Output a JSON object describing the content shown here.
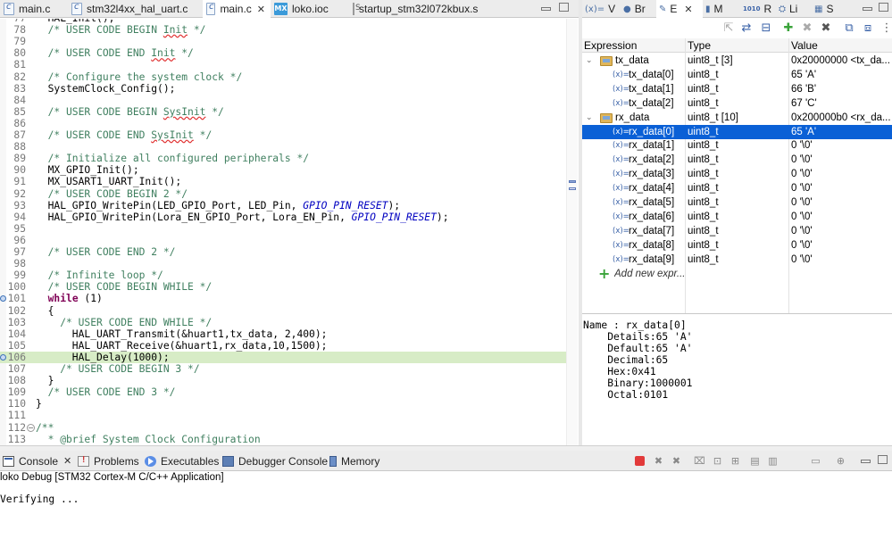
{
  "editor": {
    "tabs": [
      {
        "label": "main.c",
        "icon": "c-file-icon",
        "active": false,
        "closable": false
      },
      {
        "label": "stm32l4xx_hal_uart.c",
        "icon": "c-file-icon",
        "active": false,
        "closable": false
      },
      {
        "label": "main.c",
        "icon": "c-file-icon",
        "active": true,
        "closable": true
      },
      {
        "label": "loko.ioc",
        "icon": "mx-file-icon",
        "active": false,
        "closable": false
      },
      {
        "label": "startup_stm32l072kbux.s",
        "icon": "asm-file-icon",
        "active": false,
        "closable": false
      }
    ],
    "lines": [
      {
        "n": "77",
        "text": "  HAL_Init();"
      },
      {
        "n": "78",
        "text": "  /* USER CODE BEGIN Init */"
      },
      {
        "n": "79",
        "text": ""
      },
      {
        "n": "80",
        "text": "  /* USER CODE END Init */"
      },
      {
        "n": "81",
        "text": ""
      },
      {
        "n": "82",
        "text": "  /* Configure the system clock */"
      },
      {
        "n": "83",
        "text": "  SystemClock_Config();"
      },
      {
        "n": "84",
        "text": ""
      },
      {
        "n": "85",
        "text": "  /* USER CODE BEGIN SysInit */"
      },
      {
        "n": "86",
        "text": ""
      },
      {
        "n": "87",
        "text": "  /* USER CODE END SysInit */"
      },
      {
        "n": "88",
        "text": ""
      },
      {
        "n": "89",
        "text": "  /* Initialize all configured peripherals */"
      },
      {
        "n": "90",
        "text": "  MX_GPIO_Init();"
      },
      {
        "n": "91",
        "text": "  MX_USART1_UART_Init();"
      },
      {
        "n": "92",
        "text": "  /* USER CODE BEGIN 2 */"
      },
      {
        "n": "93",
        "text": "  HAL_GPIO_WritePin(LED_GPIO_Port, LED_Pin, GPIO_PIN_RESET);"
      },
      {
        "n": "94",
        "text": "  HAL_GPIO_WritePin(Lora_EN_GPIO_Port, Lora_EN_Pin, GPIO_PIN_RESET);"
      },
      {
        "n": "95",
        "text": ""
      },
      {
        "n": "96",
        "text": ""
      },
      {
        "n": "97",
        "text": "  /* USER CODE END 2 */"
      },
      {
        "n": "98",
        "text": ""
      },
      {
        "n": "99",
        "text": "  /* Infinite loop */"
      },
      {
        "n": "100",
        "text": "  /* USER CODE BEGIN WHILE */"
      },
      {
        "n": "101",
        "text": "  while (1)"
      },
      {
        "n": "102",
        "text": "  {"
      },
      {
        "n": "103",
        "text": "    /* USER CODE END WHILE */"
      },
      {
        "n": "104",
        "text": "      HAL_UART_Transmit(&huart1,tx_data, 2,400);"
      },
      {
        "n": "105",
        "text": "      HAL_UART_Receive(&huart1,rx_data,10,1500);"
      },
      {
        "n": "106",
        "text": "      HAL_Delay(1000);"
      },
      {
        "n": "107",
        "text": "    /* USER CODE BEGIN 3 */"
      },
      {
        "n": "108",
        "text": "  }"
      },
      {
        "n": "109",
        "text": "  /* USER CODE END 3 */"
      },
      {
        "n": "110",
        "text": "}"
      },
      {
        "n": "111",
        "text": ""
      },
      {
        "n": "112",
        "text": "/**"
      },
      {
        "n": "113",
        "text": "  * @brief System Clock Configuration"
      }
    ]
  },
  "views": {
    "tabs": [
      {
        "label": "V",
        "icon": "(x)="
      },
      {
        "label": "Br",
        "icon": "●"
      },
      {
        "label": "E",
        "icon": "✎",
        "active": true,
        "closable": true
      },
      {
        "label": "M",
        "icon": "▮"
      },
      {
        "label": "R",
        "icon": "1010"
      },
      {
        "label": "Li",
        "icon": "⛭"
      },
      {
        "label": "S",
        "icon": "▦"
      }
    ]
  },
  "expressions": {
    "columns": {
      "expression": "Expression",
      "type": "Type",
      "value": "Value"
    },
    "rows": [
      {
        "level": 0,
        "expandable": true,
        "expr": "tx_data",
        "type": "uint8_t [3]",
        "value": "0x20000000 <tx_da..."
      },
      {
        "level": 1,
        "expr": "tx_data[0]",
        "type": "uint8_t",
        "value": "65 'A'"
      },
      {
        "level": 1,
        "expr": "tx_data[1]",
        "type": "uint8_t",
        "value": "66 'B'"
      },
      {
        "level": 1,
        "expr": "tx_data[2]",
        "type": "uint8_t",
        "value": "67 'C'"
      },
      {
        "level": 0,
        "expandable": true,
        "expr": "rx_data",
        "type": "uint8_t [10]",
        "value": "0x200000b0 <rx_da..."
      },
      {
        "level": 1,
        "selected": true,
        "expr": "rx_data[0]",
        "type": "uint8_t",
        "value": "65 'A'"
      },
      {
        "level": 1,
        "expr": "rx_data[1]",
        "type": "uint8_t",
        "value": "0 '\\0'"
      },
      {
        "level": 1,
        "expr": "rx_data[2]",
        "type": "uint8_t",
        "value": "0 '\\0'"
      },
      {
        "level": 1,
        "expr": "rx_data[3]",
        "type": "uint8_t",
        "value": "0 '\\0'"
      },
      {
        "level": 1,
        "expr": "rx_data[4]",
        "type": "uint8_t",
        "value": "0 '\\0'"
      },
      {
        "level": 1,
        "expr": "rx_data[5]",
        "type": "uint8_t",
        "value": "0 '\\0'"
      },
      {
        "level": 1,
        "expr": "rx_data[6]",
        "type": "uint8_t",
        "value": "0 '\\0'"
      },
      {
        "level": 1,
        "expr": "rx_data[7]",
        "type": "uint8_t",
        "value": "0 '\\0'"
      },
      {
        "level": 1,
        "expr": "rx_data[8]",
        "type": "uint8_t",
        "value": "0 '\\0'"
      },
      {
        "level": 1,
        "expr": "rx_data[9]",
        "type": "uint8_t",
        "value": "0 '\\0'"
      }
    ],
    "add_label": "Add new expr..."
  },
  "details": {
    "lines": [
      "Name : rx_data[0]",
      "    Details:65 'A'",
      "    Default:65 'A'",
      "    Decimal:65",
      "    Hex:0x41",
      "    Binary:1000001",
      "    Octal:0101"
    ]
  },
  "console": {
    "tabs": [
      {
        "label": "Console",
        "icon": "console-icon",
        "closable": true
      },
      {
        "label": "Problems",
        "icon": "problems-icon"
      },
      {
        "label": "Executables",
        "icon": "executables-icon"
      },
      {
        "label": "Debugger Console",
        "icon": "debugger-console-icon"
      },
      {
        "label": "Memory",
        "icon": "memory-icon"
      }
    ],
    "title": "loko Debug [STM32 Cortex-M C/C++ Application]",
    "output": "Verifying ..."
  },
  "colors": {
    "selection": "#0a60d6",
    "current_line": "#d7ecc6",
    "keyword": "#7f0055",
    "comment": "#3f7f5f",
    "macro": "#0000c0"
  }
}
